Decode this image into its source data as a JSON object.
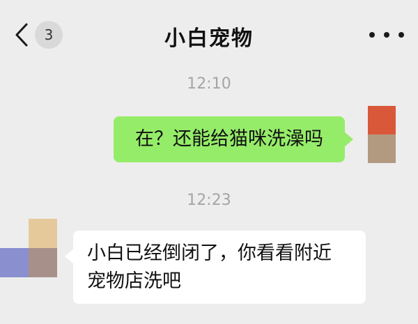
{
  "header": {
    "title": "小白宠物",
    "unread_count": "3",
    "back_icon": "chevron-left-icon",
    "more_icon": "more-dots-icon"
  },
  "messages": [
    {
      "time": "12:10",
      "direction": "outgoing",
      "lines": [
        "在？还能给猫咪洗澡吗"
      ]
    },
    {
      "time": "12:23",
      "direction": "incoming",
      "lines": [
        "小白已经倒闭了，你看看附近",
        "宠物店洗吧"
      ]
    }
  ],
  "colors": {
    "background": "#ededed",
    "outgoing_bubble": "#95ec69",
    "incoming_bubble": "#ffffff",
    "timestamp": "#a5a5a5"
  }
}
